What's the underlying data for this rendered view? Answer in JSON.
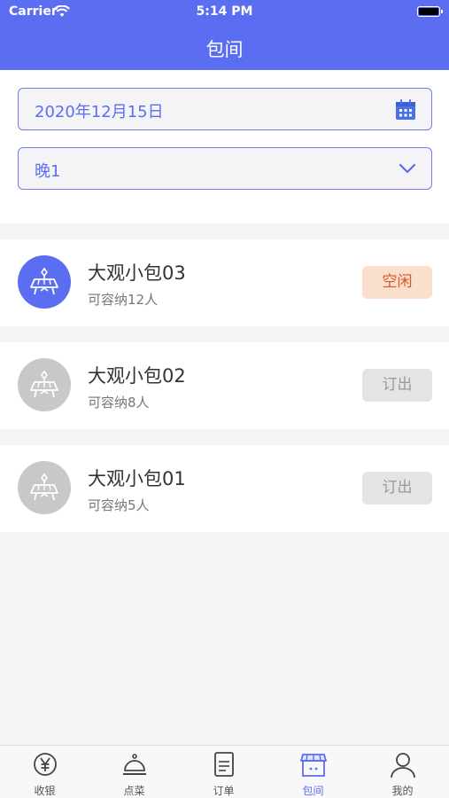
{
  "status_bar": {
    "carrier": "Carrier",
    "time": "5:14 PM"
  },
  "nav": {
    "title": "包间"
  },
  "filters": {
    "date": "2020年12月15日",
    "time_slot": "晚1"
  },
  "rooms": [
    {
      "name": "大观小包03",
      "capacity": "可容纳12人",
      "status": "空闲"
    },
    {
      "name": "大观小包02",
      "capacity": "可容纳8人",
      "status": "订出"
    },
    {
      "name": "大观小包01",
      "capacity": "可容纳5人",
      "status": "订出"
    }
  ],
  "tabbar": {
    "items": [
      {
        "label": "收银"
      },
      {
        "label": "点菜"
      },
      {
        "label": "订单"
      },
      {
        "label": "包间"
      },
      {
        "label": "我的"
      }
    ]
  },
  "colors": {
    "accent": "#5b6ef2",
    "free_badge_bg": "#fbdfcd",
    "free_badge_text": "#d5572a",
    "booked_badge_bg": "#e4e4e4",
    "inactive_avatar": "#c8c8c8"
  }
}
